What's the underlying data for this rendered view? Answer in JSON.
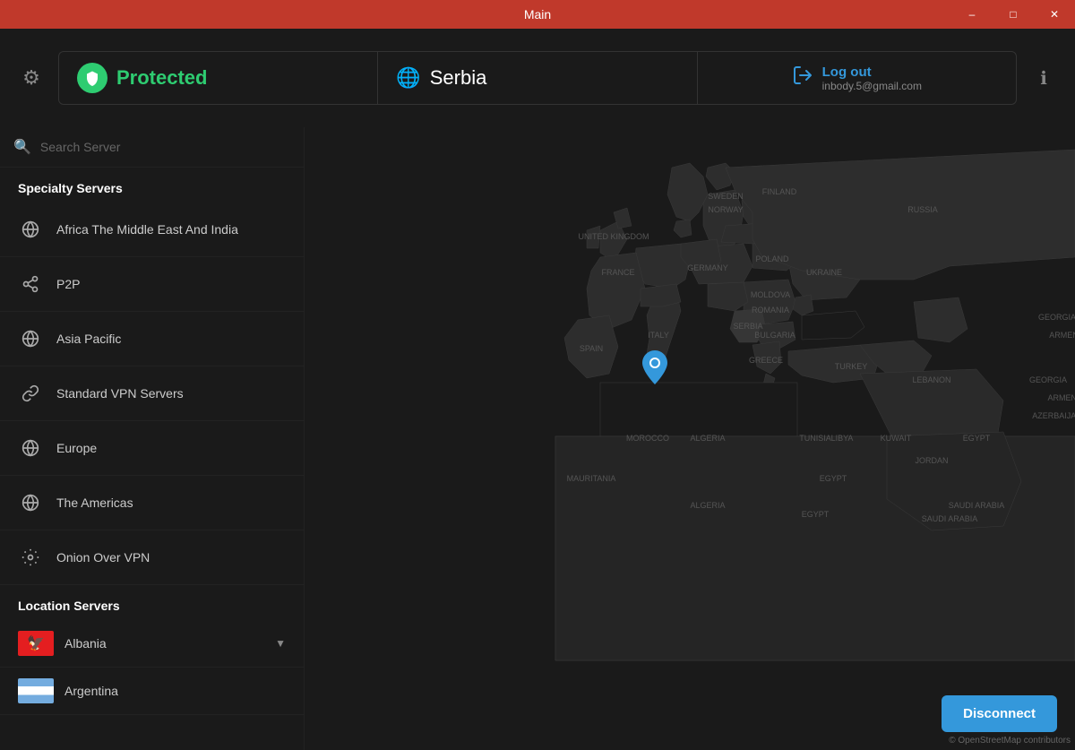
{
  "titleBar": {
    "title": "Main",
    "controls": {
      "minimize": "–",
      "maximize": "□",
      "close": "✕"
    }
  },
  "header": {
    "settingsLabel": "⚙",
    "infoLabel": "ℹ",
    "status": {
      "protectedLabel": "Protected",
      "locationLabel": "Serbia",
      "logoutLabel": "Log out",
      "email": "inbody.5@gmail.com"
    }
  },
  "sidebar": {
    "searchPlaceholder": "Search Server",
    "specialtySection": "Specialty Servers",
    "specialtyItems": [
      {
        "id": "africa",
        "icon": "globe",
        "label": "Africa The Middle East And India"
      },
      {
        "id": "p2p",
        "icon": "share",
        "label": "P2P"
      },
      {
        "id": "asiapacific",
        "icon": "globe",
        "label": "Asia Pacific"
      },
      {
        "id": "standardvpn",
        "icon": "vpn",
        "label": "Standard VPN Servers"
      },
      {
        "id": "europe",
        "icon": "globe",
        "label": "Europe"
      },
      {
        "id": "americas",
        "icon": "globe",
        "label": "The Americas"
      },
      {
        "id": "onion",
        "icon": "onion",
        "label": "Onion Over VPN"
      }
    ],
    "locationSection": "Location Servers",
    "countryItems": [
      {
        "id": "albania",
        "name": "Albania",
        "flagType": "albania"
      },
      {
        "id": "argentina",
        "name": "Argentina",
        "flagType": "argentina"
      }
    ]
  },
  "map": {
    "pinLocation": "Serbia",
    "disconnectLabel": "Disconnect",
    "credit": "© OpenStreetMap contributors"
  }
}
